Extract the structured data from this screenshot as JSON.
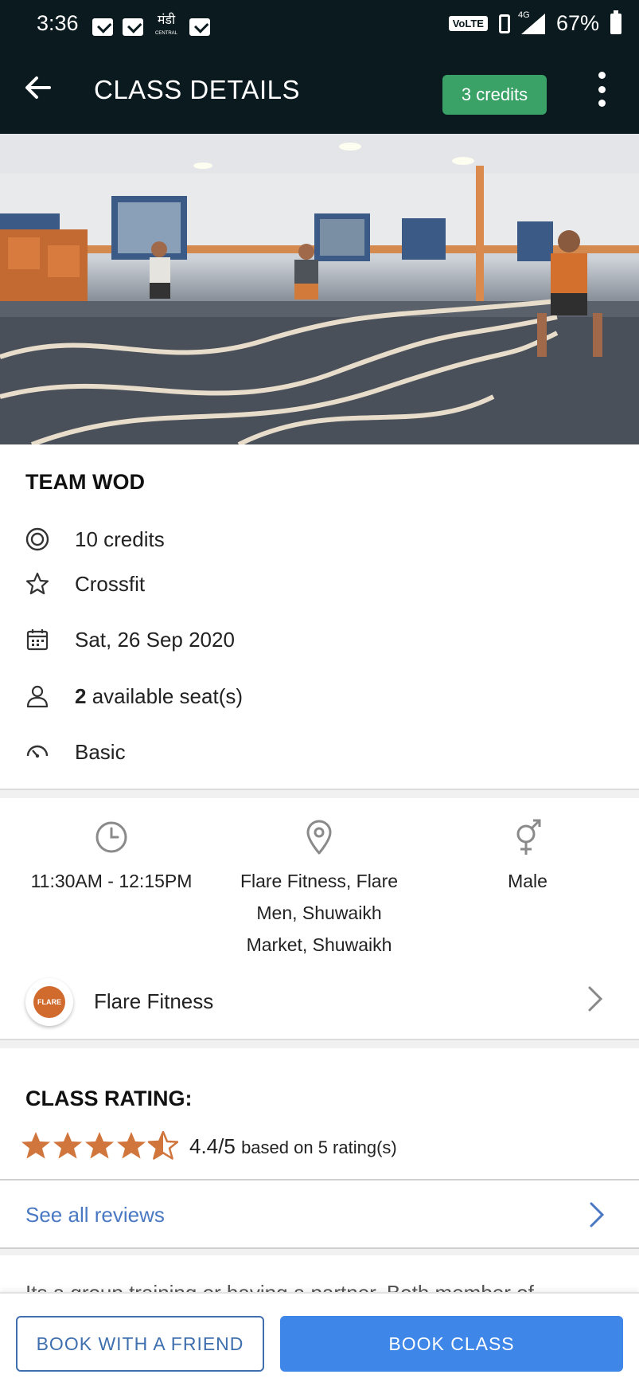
{
  "status_bar": {
    "time": "3:36",
    "hindi_label": "मंडी",
    "hindi_sublabel": "CENTRAL",
    "volte": "VoLTE",
    "network": "4G",
    "battery": "67%"
  },
  "app_bar": {
    "title": "CLASS DETAILS",
    "credits_chip": "3 credits"
  },
  "class": {
    "name": "TEAM WOD",
    "credits": "10 credits",
    "category": "Crossfit",
    "date": "Sat, 26 Sep 2020",
    "seats_count": "2",
    "seats_label": " available seat(s)",
    "level": "Basic"
  },
  "details": {
    "time": "11:30AM - 12:15PM",
    "location_lines": [
      "Flare Fitness, Flare",
      "Men, Shuwaikh",
      "Market, Shuwaikh"
    ],
    "gender": "Male"
  },
  "gym": {
    "name": "Flare Fitness",
    "logo_text": "FLARE"
  },
  "rating": {
    "title": "CLASS RATING:",
    "score": "4.4/5",
    "basis": "based on 5 rating(s)",
    "stars_value": 4.4,
    "star_color": "#d0753b"
  },
  "reviews_link": "See all reviews",
  "description_partial": "Its a group training or having a partner. Both member of",
  "buttons": {
    "book_with_friend": "BOOK WITH A FRIEND",
    "book_class": "BOOK CLASS"
  },
  "colors": {
    "app_bar": "#0b1a1e",
    "credits_chip": "#3aa267",
    "primary_button": "#3e86e8",
    "link": "#4a78c2"
  }
}
